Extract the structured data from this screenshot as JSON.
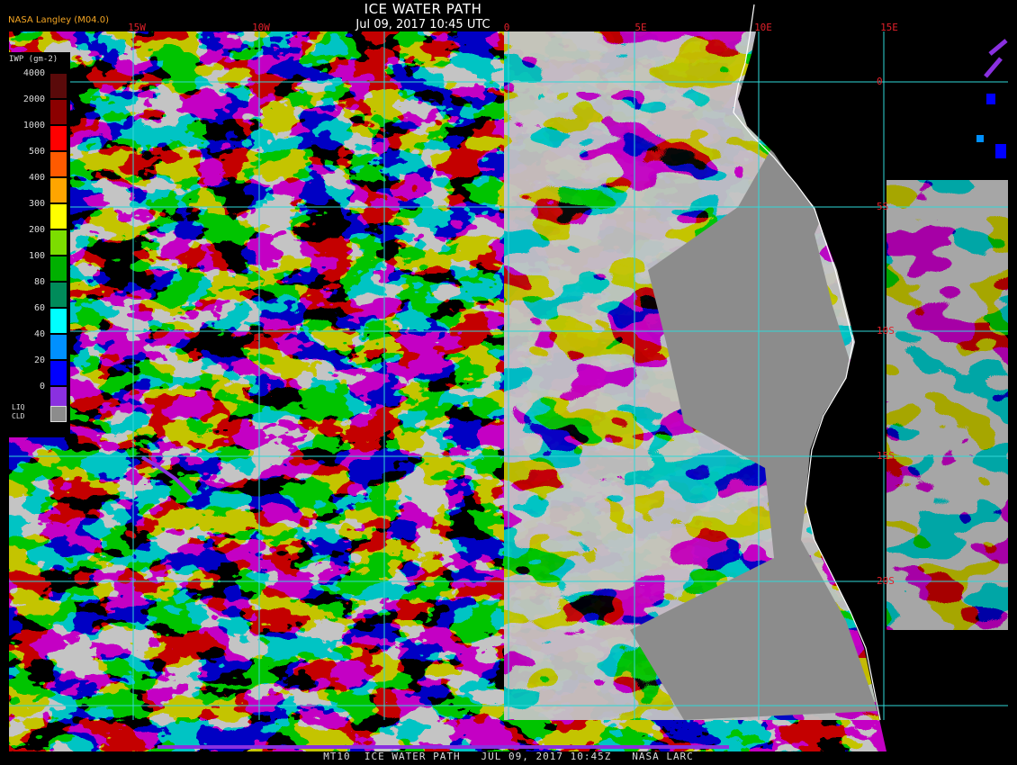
{
  "title": "ICE WATER PATH",
  "date_line": "Jul 09, 2017 10:45 UTC",
  "credit": "NASA Langley (M04.0)",
  "footer": "MT10  ICE WATER PATH   JUL 09, 2017 10:45Z   NASA LARC",
  "longitude_labels": [
    "15W",
    "10W",
    "0",
    "5E",
    "10E",
    "15E"
  ],
  "latitude_labels": [
    "0",
    "5S",
    "10S",
    "15S",
    "20S"
  ],
  "legend": {
    "title": "IWP (gm-2)",
    "entries": [
      {
        "label": "4000",
        "color": "#5a0a0a"
      },
      {
        "label": "2000",
        "color": "#8b0000"
      },
      {
        "label": "1000",
        "color": "#ff0000"
      },
      {
        "label": "500",
        "color": "#ff5a00"
      },
      {
        "label": "400",
        "color": "#ffa500"
      },
      {
        "label": "300",
        "color": "#ffff00"
      },
      {
        "label": "200",
        "color": "#7cdd00"
      },
      {
        "label": "100",
        "color": "#00b000"
      },
      {
        "label": "80",
        "color": "#008b5a"
      },
      {
        "label": "60",
        "color": "#00ffff"
      },
      {
        "label": "40",
        "color": "#0090ff"
      },
      {
        "label": "20",
        "color": "#0000ff"
      },
      {
        "label": "0",
        "color": "#8a30e0"
      }
    ],
    "liq_label": "LIQ CLD",
    "liq_color": "#8c8c8c"
  },
  "colors": {
    "background": "#000000",
    "liquid_cloud": "#8c8c8c",
    "grid": "#30d8d8",
    "label": "#e0202a",
    "coastline": "#ffffff",
    "ice_low": "#8a30e0"
  }
}
